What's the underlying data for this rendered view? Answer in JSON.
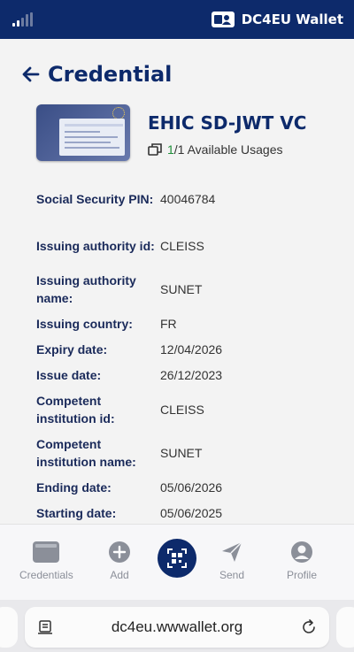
{
  "header": {
    "brand_title": "DC4EU Wallet",
    "brand_color": "#0d2a6b",
    "signal_icon": "signal-icon",
    "logo_icon": "wallet-logo-icon"
  },
  "page": {
    "title": "Credential",
    "back_icon": "arrow-left-icon"
  },
  "credential": {
    "name": "EHIC SD-JWT VC",
    "usage_count": "1",
    "usage_rest": "/1 Available Usages",
    "usage_icon": "copies-icon"
  },
  "fields": [
    {
      "label": "Social Security PIN:",
      "value": "40046784"
    },
    {
      "label": "Issuing authority id:",
      "value": "CLEISS"
    },
    {
      "label": "Issuing authority name:",
      "value": "SUNET"
    },
    {
      "label": "Issuing country:",
      "value": "FR"
    },
    {
      "label": "Expiry date:",
      "value": "12/04/2026"
    },
    {
      "label": "Issue date:",
      "value": "26/12/2023"
    },
    {
      "label": "Competent institution id:",
      "value": "CLEISS"
    },
    {
      "label": "Competent institution name:",
      "value": "SUNET"
    },
    {
      "label": "Ending date:",
      "value": "05/06/2026"
    },
    {
      "label": "Starting date:",
      "value": "05/06/2025"
    }
  ],
  "nav": {
    "credentials": "Credentials",
    "add": "Add",
    "send": "Send",
    "profile": "Profile",
    "scan_icon": "qr-scan-icon"
  },
  "browser": {
    "url": "dc4eu.wwwallet.org",
    "reader_icon": "reader-icon",
    "reload_icon": "reload-icon"
  }
}
